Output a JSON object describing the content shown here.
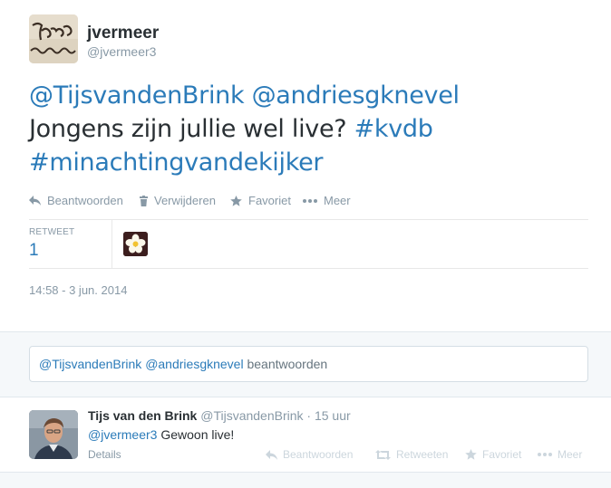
{
  "tweet": {
    "fullname": "jvermeer",
    "username": "@jvermeer3",
    "text_line1_mentions": "@TijsvandenBrink @andriesgknevel",
    "text_line2_plain": "Jongens zijn jullie wel live? ",
    "text_line2_hashtag": "#kvdb",
    "text_line3_hashtag": "#minachtingvandekijker",
    "actions": {
      "reply": "Beantwoorden",
      "delete": "Verwijderen",
      "favorite": "Favoriet",
      "more": "Meer"
    },
    "stats": {
      "retweet_label": "RETWEET",
      "retweet_count": "1"
    },
    "timestamp": "14:58 - 3 jun. 2014"
  },
  "reply_box": {
    "mention1": "@TijsvandenBrink",
    "mention2": "@andriesgknevel",
    "suffix": "beantwoorden"
  },
  "reply_tweet": {
    "name": "Tijs van den Brink",
    "handle": "@TijsvandenBrink",
    "time": "· 15 uur",
    "mention": "@jvermeer3",
    "text": "Gewoon live!",
    "details": "Details",
    "actions": {
      "reply": "Beantwoorden",
      "retweet": "Retweeten",
      "favorite": "Favoriet",
      "more": "Meer"
    }
  },
  "colors": {
    "link": "#2b7bb9",
    "muted": "#8899a6",
    "text": "#292f33",
    "background_alt": "#f5f8fa"
  }
}
